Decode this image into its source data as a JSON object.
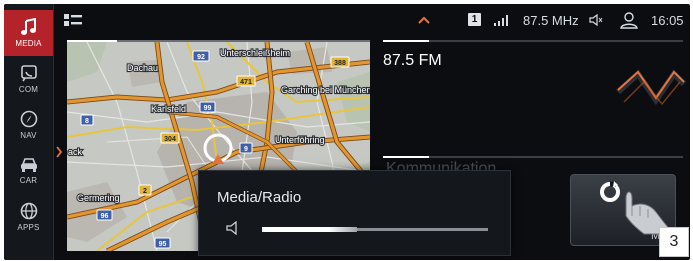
{
  "sidebar": {
    "items": [
      {
        "label": "MEDIA",
        "icon": "music-note-icon",
        "active": true
      },
      {
        "label": "COM",
        "icon": "phone-icon",
        "active": false
      },
      {
        "label": "NAV",
        "icon": "compass-icon",
        "active": false
      },
      {
        "label": "CAR",
        "icon": "car-icon",
        "active": false
      },
      {
        "label": "APPS",
        "icon": "globe-icon",
        "active": false
      }
    ]
  },
  "statusbar": {
    "dab_badge": "1",
    "frequency": "87.5 MHz",
    "clock": "16:05"
  },
  "map": {
    "places": [
      "Dachau",
      "Unterschleißheim",
      "Garching bei München",
      "Karlsfeld",
      "Unterföhring",
      "Germering",
      "ack"
    ],
    "road_shields": [
      "92",
      "471",
      "388",
      "99",
      "8",
      "304",
      "9",
      "2",
      "96",
      "95"
    ]
  },
  "radio": {
    "station": "87.5 FM"
  },
  "communication": {
    "title": "Kommunikation",
    "subtitle": "&i",
    "card_partial": "M"
  },
  "popup": {
    "title": "Media/Radio",
    "volume_level": 0.42
  },
  "figure_number": "3",
  "colors": {
    "accent_red": "#b4232a",
    "highlight_orange": "#e8743c",
    "road_orange": "#e3962f",
    "background": "#0b0d10"
  }
}
